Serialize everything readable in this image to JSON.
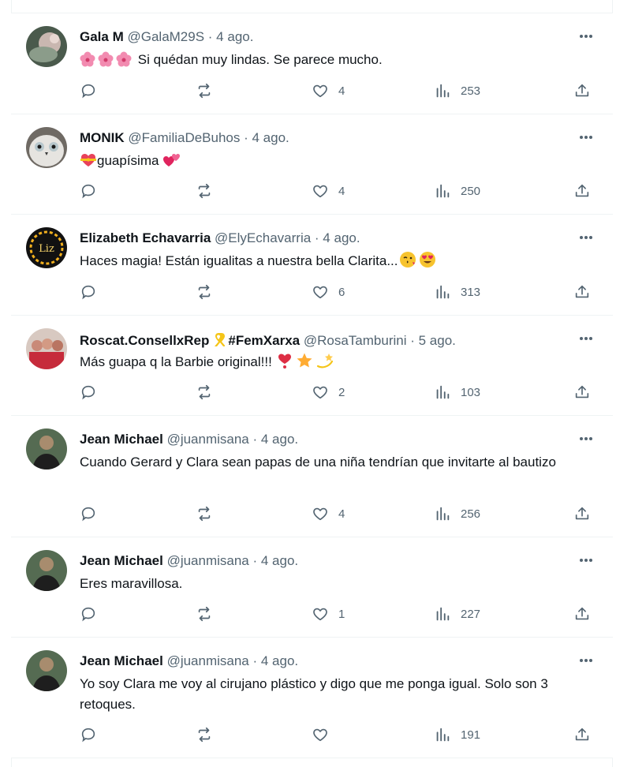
{
  "colors": {
    "text": "#0f1419",
    "muted": "#536471",
    "border": "#eff3f4"
  },
  "tweets": [
    {
      "name": "Gala M",
      "handle": "@GalaM29S",
      "date": "· 4 ago.",
      "text": "Si quédan muy lindas. Se parece mucho.",
      "emoji": [
        "hibiscus",
        "hibiscus",
        "hibiscus"
      ],
      "avatar": "flower-photo",
      "replies": "",
      "retweets": "",
      "likes": "4",
      "views": "253"
    },
    {
      "name": "MONIK",
      "handle": "@FamiliaDeBuhos",
      "date": "· 4 ago.",
      "text": "guapísima",
      "emoji_before": [
        "heart-with-ribbon"
      ],
      "emoji_after": [
        "two-hearts"
      ],
      "avatar": "owl-photo",
      "replies": "",
      "retweets": "",
      "likes": "4",
      "views": "250"
    },
    {
      "name": "Elizabeth Echavarria",
      "handle": "@ElyEchavarria",
      "date": "· 4 ago.",
      "text": "Haces magia! Están igualitas a nuestra bella Clarita...",
      "emoji_after": [
        "face-blowing-kiss",
        "heart-eyes"
      ],
      "avatar": "liz-logo",
      "avatar_text": "Liz",
      "replies": "",
      "retweets": "",
      "likes": "6",
      "views": "313"
    },
    {
      "name": "Roscat.ConsellxRep",
      "badge": "yellow-ribbon-icon",
      "name_suffix": "#FemXarxa",
      "handle": "@RosaTamburini",
      "date": "· 5 ago.",
      "text": "Más guapa q la Barbie original!!!",
      "emoji_after": [
        "heart-exclamation",
        "star",
        "dizzy"
      ],
      "avatar": "group-photo",
      "replies": "",
      "retweets": "",
      "likes": "2",
      "views": "103"
    },
    {
      "name": "Jean Michael",
      "handle": "@juanmisana",
      "date": "· 4 ago.",
      "text": "Cuando Gerard y Clara sean papas de una niña tendrían que invitarte al bautizo",
      "avatar": "man-photo",
      "replies": "",
      "retweets": "",
      "likes": "4",
      "views": "256"
    },
    {
      "name": "Jean Michael",
      "handle": "@juanmisana",
      "date": "· 4 ago.",
      "text": "Eres maravillosa.",
      "avatar": "man-photo",
      "replies": "",
      "retweets": "",
      "likes": "1",
      "views": "227"
    },
    {
      "name": "Jean Michael",
      "handle": "@juanmisana",
      "date": "· 4 ago.",
      "text": "Yo soy Clara me voy al cirujano plástico y digo que me ponga igual. Solo son 3 retoques.",
      "avatar": "man-photo",
      "replies": "",
      "retweets": "",
      "likes": "",
      "views": "191"
    }
  ]
}
